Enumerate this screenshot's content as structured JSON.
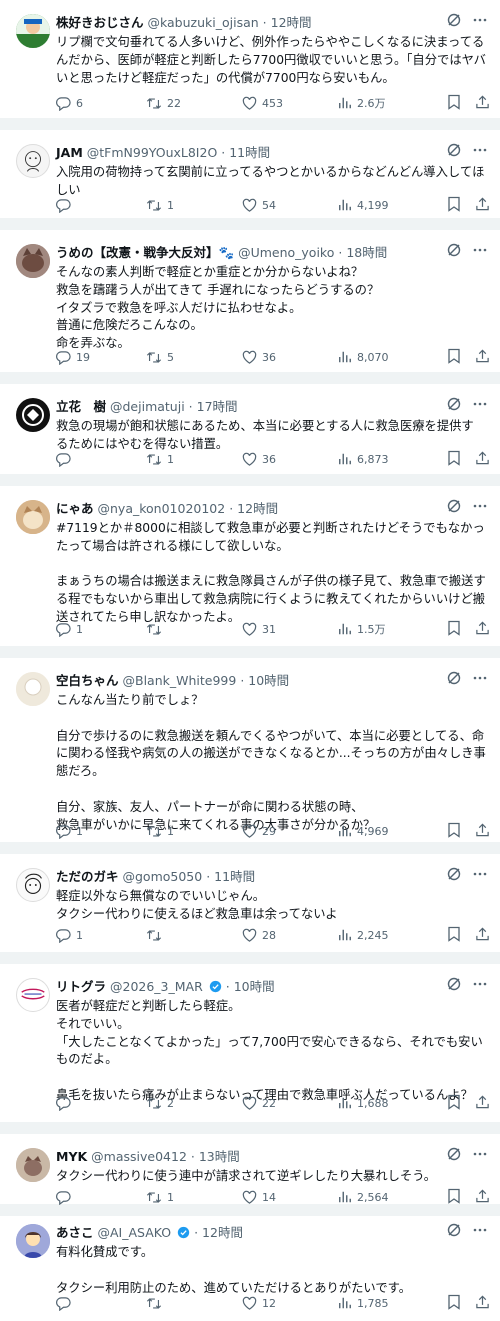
{
  "colors": {
    "text": "#0f1419",
    "muted": "#536471",
    "separator": "#eff3f4",
    "verified": "#1d9bf0"
  },
  "tweets": [
    {
      "name": "株好きおじさん",
      "handle": "@kabuzuki_ojisan",
      "time": "12時間",
      "verified": false,
      "text": "リプ欄で文句垂れてる人多いけど、例外作ったらややこしくなるに決まってるんだから、医師が軽症と判断したら7700円徴収でいいと思う。「自分ではヤバいと思ったけど軽症だった」の代償が7700円なら安いもん。",
      "replies": "6",
      "retweets": "22",
      "likes": "453",
      "views": "2.6万"
    },
    {
      "name": "JAM",
      "handle": "@tFmN99YOuxL8I2O",
      "time": "11時間",
      "verified": false,
      "text": "入院用の荷物持って玄関前に立ってるやつとかいるからなどんどん導入してほしい",
      "replies": "",
      "retweets": "1",
      "likes": "54",
      "views": "4,199"
    },
    {
      "name": "うめの【改憲・戦争大反対】🐾",
      "handle": "@Umeno_yoiko",
      "time": "18時間",
      "verified": false,
      "text": "そんなの素人判断で軽症とか重症とか分からないよね？\n救急を躊躇う人が出てきて 手遅れになったらどうするの？\nイタズラで救急を呼ぶ人だけに払わせなよ。\n普通に危険だろこんなの。\n命を弄ぶな。",
      "replies": "19",
      "retweets": "5",
      "likes": "36",
      "views": "8,070"
    },
    {
      "name": "立花　樹",
      "handle": "@dejimatuji",
      "time": "17時間",
      "verified": false,
      "text": "救急の現場が飽和状態にあるため、本当に必要とする人に救急医療を提供するためにはやむを得ない措置。",
      "replies": "",
      "retweets": "1",
      "likes": "36",
      "views": "6,873"
    },
    {
      "name": "にゃあ",
      "handle": "@nya_kon01020102",
      "time": "12時間",
      "verified": false,
      "text": "#7119とか＃8000に相談して救急車が必要と判断されたけどそうでもなかったって場合は許される様にして欲しいな。\n\nまぁうちの場合は搬送まえに救急隊員さんが子供の様子見て、救急車で搬送する程でもないから車出して救急病院に行くように教えてくれたからいいけど搬送されてたら申し訳なかったよ。",
      "replies": "1",
      "retweets": "",
      "likes": "31",
      "views": "1.5万"
    },
    {
      "name": "空白ちゃん",
      "handle": "@Blank_White999",
      "time": "10時間",
      "verified": false,
      "text": "こんなん当たり前でしょ？\n\n自分で歩けるのに救急搬送を頼んでくるやつがいて、本当に必要としてる、命に関わる怪我や病気の人の搬送ができなくなるとか...そっちの方が由々しき事態だろ。\n\n自分、家族、友人、パートナーが命に関わる状態の時、\n救急車がいかに早急に来てくれる事の大事さが分かるか？",
      "replies": "1",
      "retweets": "1",
      "likes": "29",
      "views": "4,969"
    },
    {
      "name": "ただのガキ",
      "handle": "@gomo5050",
      "time": "11時間",
      "verified": false,
      "text": "軽症以外なら無償なのでいいじゃん。\nタクシー代わりに使えるほど救急車は余ってないよ",
      "replies": "1",
      "retweets": "",
      "likes": "28",
      "views": "2,245"
    },
    {
      "name": "リトグラ",
      "handle": "@2026_3_MAR",
      "time": "10時間",
      "verified": true,
      "text": "医者が軽症だと判断したら軽症。\nそれでいい。\n「大したことなくてよかった」って7,700円で安心できるなら、それでも安いものだよ。\n\n鼻毛を抜いたら痛みが止まらないって理由で救急車呼ぶ人だっているんよ？",
      "replies": "",
      "retweets": "2",
      "likes": "22",
      "views": "1,688"
    },
    {
      "name": "MYK",
      "handle": "@massive0412",
      "time": "13時間",
      "verified": false,
      "text": "タクシー代わりに使う連中が請求されて逆ギレしたり大暴れしそう。",
      "replies": "",
      "retweets": "1",
      "likes": "14",
      "views": "2,564"
    },
    {
      "name": "あさこ",
      "handle": "@AI_ASAKO",
      "time": "12時間",
      "verified": true,
      "text": "有料化賛成です。\n\nタクシー利用防止のため、進めていただけるとありがたいです。",
      "replies": "",
      "retweets": "",
      "likes": "12",
      "views": "1,785"
    }
  ]
}
